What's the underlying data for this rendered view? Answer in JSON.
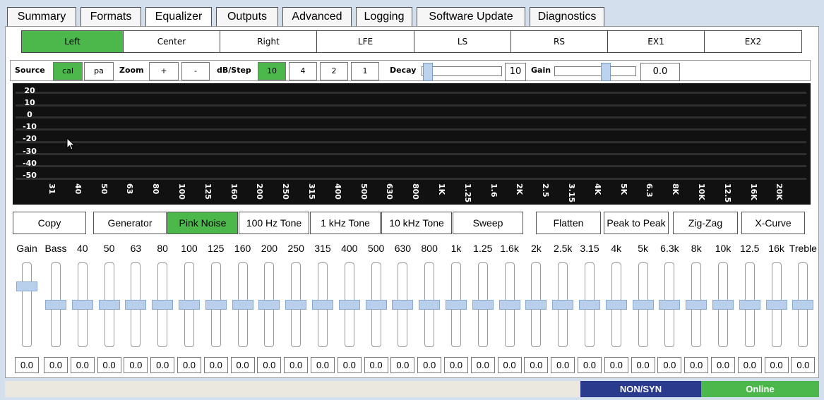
{
  "tabs": [
    {
      "label": "Summary",
      "active": false
    },
    {
      "label": "Formats",
      "active": false
    },
    {
      "label": "Equalizer",
      "active": true
    },
    {
      "label": "Outputs",
      "active": false
    },
    {
      "label": "Advanced",
      "active": false
    },
    {
      "label": "Logging",
      "active": false
    },
    {
      "label": "Software Update",
      "active": false
    },
    {
      "label": "Diagnostics",
      "active": false
    }
  ],
  "channels": [
    {
      "label": "Left",
      "selected": true
    },
    {
      "label": "Center",
      "selected": false
    },
    {
      "label": "Right",
      "selected": false
    },
    {
      "label": "LFE",
      "selected": false
    },
    {
      "label": "LS",
      "selected": false
    },
    {
      "label": "RS",
      "selected": false
    },
    {
      "label": "EX1",
      "selected": false
    },
    {
      "label": "EX2",
      "selected": false
    }
  ],
  "controls": {
    "source_label": "Source",
    "source_cal": "cal",
    "source_pa": "pa",
    "source_selected": "cal",
    "zoom_label": "Zoom",
    "zoom_in": "+",
    "zoom_out": "-",
    "dbstep_label": "dB/Step",
    "dbsteps": [
      "10",
      "4",
      "2",
      "1"
    ],
    "dbstep_selected": "10",
    "decay_label": "Decay",
    "decay_value": "10",
    "gain_label": "Gain",
    "gain_value": "0.0"
  },
  "graph": {
    "y_labels": [
      "20",
      "10",
      "0",
      "-10",
      "-20",
      "-30",
      "-40",
      "-50"
    ],
    "x_labels": [
      "31",
      "40",
      "50",
      "63",
      "80",
      "100",
      "125",
      "160",
      "200",
      "250",
      "315",
      "400",
      "500",
      "630",
      "800",
      "1K",
      "1.25",
      "1.6",
      "2K",
      "2.5",
      "3.15",
      "4K",
      "5K",
      "6.3",
      "8K",
      "10K",
      "12.5",
      "16K",
      "20K"
    ]
  },
  "actions": {
    "copy": "Copy",
    "generator": "Generator",
    "pink_noise": "Pink Noise",
    "tone_100": "100 Hz Tone",
    "tone_1k": "1 kHz Tone",
    "tone_10k": "10 kHz Tone",
    "sweep": "Sweep",
    "flatten": "Flatten",
    "peak_to_peak": "Peak to Peak",
    "zig_zag": "Zig-Zag",
    "x_curve": "X-Curve",
    "selected_generator": "Pink Noise"
  },
  "bands": [
    {
      "label": "Gain",
      "value": "0.0",
      "level": 0.75
    },
    {
      "label": "Bass",
      "value": "0.0",
      "level": 0.5
    },
    {
      "label": "40",
      "value": "0.0",
      "level": 0.5
    },
    {
      "label": "50",
      "value": "0.0",
      "level": 0.5
    },
    {
      "label": "63",
      "value": "0.0",
      "level": 0.5
    },
    {
      "label": "80",
      "value": "0.0",
      "level": 0.5
    },
    {
      "label": "100",
      "value": "0.0",
      "level": 0.5
    },
    {
      "label": "125",
      "value": "0.0",
      "level": 0.5
    },
    {
      "label": "160",
      "value": "0.0",
      "level": 0.5
    },
    {
      "label": "200",
      "value": "0.0",
      "level": 0.5
    },
    {
      "label": "250",
      "value": "0.0",
      "level": 0.5
    },
    {
      "label": "315",
      "value": "0.0",
      "level": 0.5
    },
    {
      "label": "400",
      "value": "0.0",
      "level": 0.5
    },
    {
      "label": "500",
      "value": "0.0",
      "level": 0.5
    },
    {
      "label": "630",
      "value": "0.0",
      "level": 0.5
    },
    {
      "label": "800",
      "value": "0.0",
      "level": 0.5
    },
    {
      "label": "1k",
      "value": "0.0",
      "level": 0.5
    },
    {
      "label": "1.25",
      "value": "0.0",
      "level": 0.5
    },
    {
      "label": "1.6k",
      "value": "0.0",
      "level": 0.5
    },
    {
      "label": "2k",
      "value": "0.0",
      "level": 0.5
    },
    {
      "label": "2.5k",
      "value": "0.0",
      "level": 0.5
    },
    {
      "label": "3.15",
      "value": "0.0",
      "level": 0.5
    },
    {
      "label": "4k",
      "value": "0.0",
      "level": 0.5
    },
    {
      "label": "5k",
      "value": "0.0",
      "level": 0.5
    },
    {
      "label": "6.3k",
      "value": "0.0",
      "level": 0.5
    },
    {
      "label": "8k",
      "value": "0.0",
      "level": 0.5
    },
    {
      "label": "10k",
      "value": "0.0",
      "level": 0.5
    },
    {
      "label": "12.5",
      "value": "0.0",
      "level": 0.5
    },
    {
      "label": "16k",
      "value": "0.0",
      "level": 0.5
    },
    {
      "label": "Treble",
      "value": "0.0",
      "level": 0.5
    }
  ],
  "status": {
    "sync": "NON/SYN",
    "connection": "Online"
  },
  "colors": {
    "selected_green": "#4cb84c",
    "status_sync_bg": "#2a3a8c",
    "status_online_bg": "#4cb84c",
    "graph_bg": "#111111",
    "slider_thumb": "#b9d0ec"
  }
}
